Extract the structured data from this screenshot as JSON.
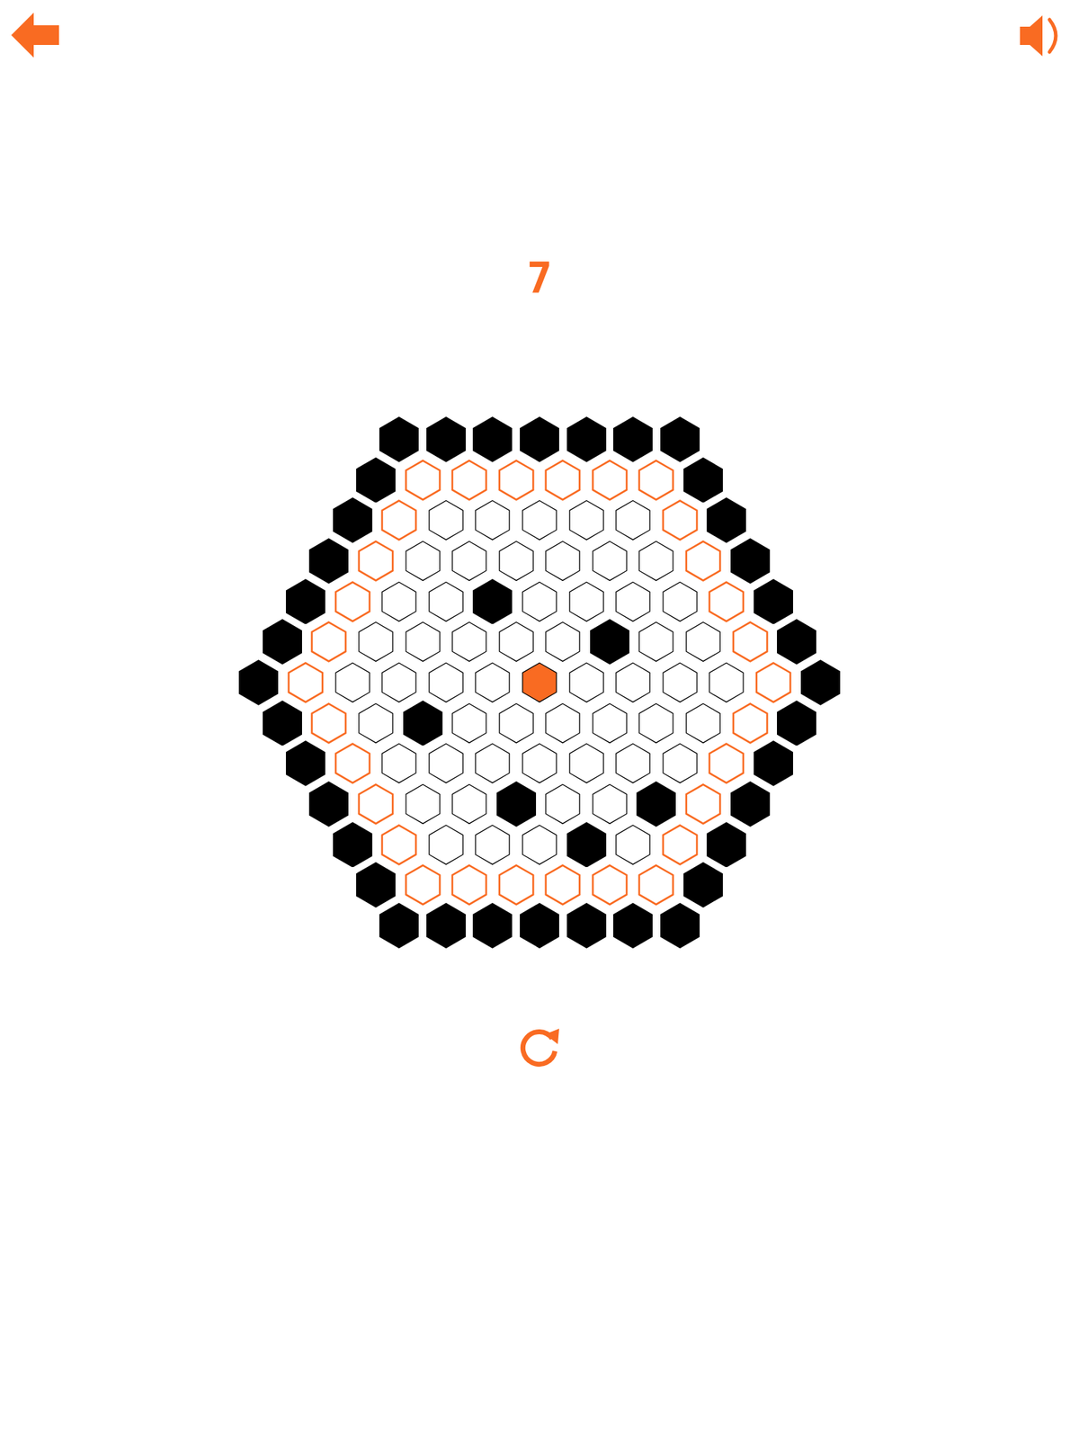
{
  "level": "7",
  "board": {
    "rows": [
      [
        "wall",
        "wall",
        "wall",
        "wall",
        "wall",
        "wall",
        "wall"
      ],
      [
        "wall",
        "edge",
        "edge",
        "edge",
        "edge",
        "edge",
        "edge",
        "wall"
      ],
      [
        "wall",
        "edge",
        "empty",
        "empty",
        "empty",
        "empty",
        "empty",
        "edge",
        "wall"
      ],
      [
        "wall",
        "edge",
        "empty",
        "empty",
        "empty",
        "empty",
        "empty",
        "empty",
        "edge",
        "wall"
      ],
      [
        "wall",
        "edge",
        "empty",
        "empty",
        "wall",
        "empty",
        "empty",
        "empty",
        "empty",
        "edge",
        "wall"
      ],
      [
        "wall",
        "edge",
        "empty",
        "empty",
        "empty",
        "empty",
        "empty",
        "wall",
        "empty",
        "empty",
        "edge",
        "wall"
      ],
      [
        "wall",
        "edge",
        "empty",
        "empty",
        "empty",
        "empty",
        "cat",
        "empty",
        "empty",
        "empty",
        "empty",
        "edge",
        "wall"
      ],
      [
        "wall",
        "edge",
        "empty",
        "wall",
        "empty",
        "empty",
        "empty",
        "empty",
        "empty",
        "empty",
        "edge",
        "wall"
      ],
      [
        "wall",
        "edge",
        "empty",
        "empty",
        "empty",
        "empty",
        "empty",
        "empty",
        "empty",
        "edge",
        "wall"
      ],
      [
        "wall",
        "edge",
        "empty",
        "empty",
        "wall",
        "empty",
        "empty",
        "wall",
        "edge",
        "wall"
      ],
      [
        "wall",
        "edge",
        "empty",
        "empty",
        "empty",
        "wall",
        "empty",
        "edge",
        "wall"
      ],
      [
        "wall",
        "edge",
        "edge",
        "edge",
        "edge",
        "edge",
        "edge",
        "wall"
      ],
      [
        "wall",
        "wall",
        "wall",
        "wall",
        "wall",
        "wall",
        "wall"
      ]
    ]
  }
}
